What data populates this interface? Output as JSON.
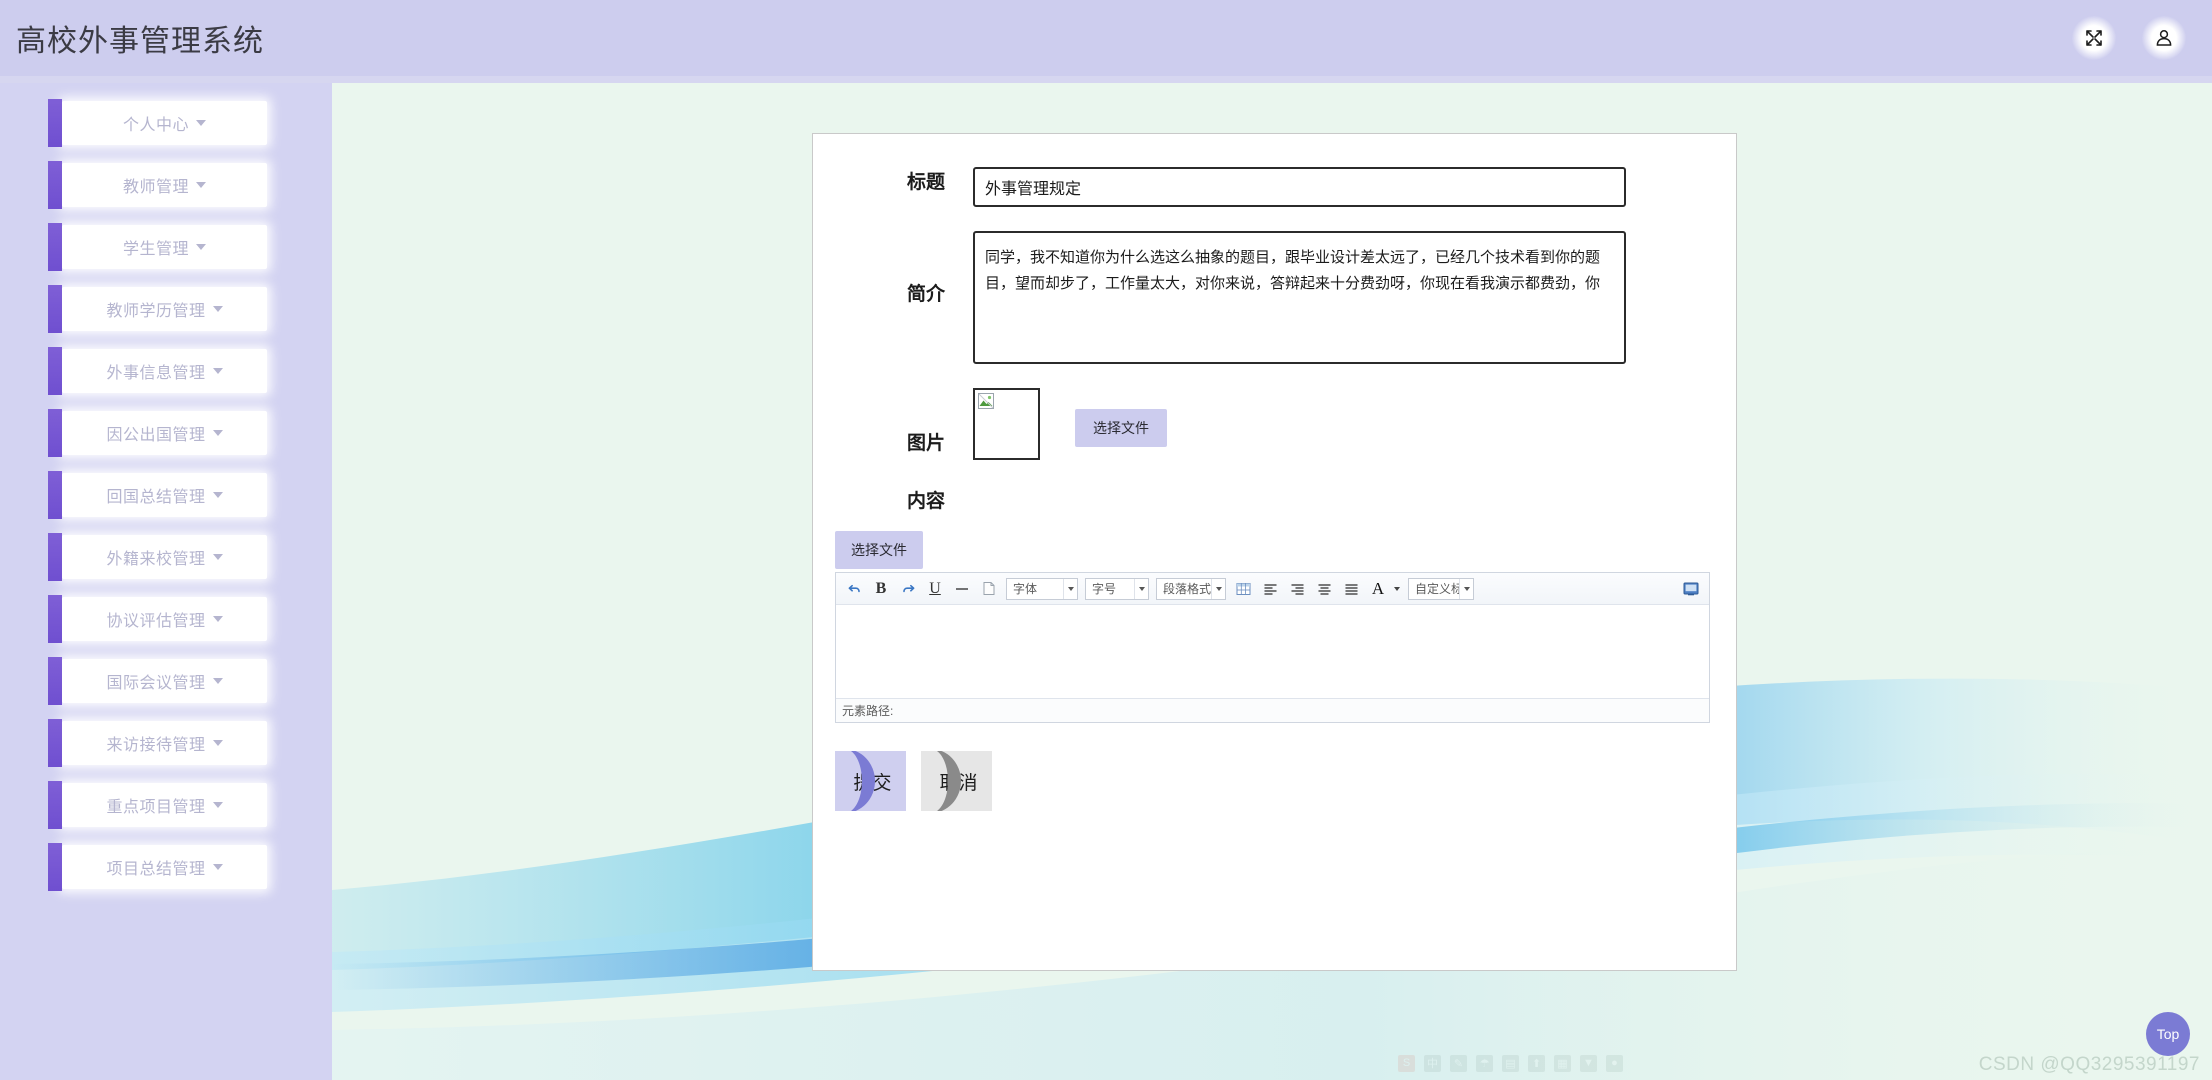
{
  "header": {
    "title": "高校外事管理系统",
    "icons": [
      {
        "name": "expand-icon",
        "label": "全屏"
      },
      {
        "name": "user-icon",
        "label": "用户"
      }
    ]
  },
  "sidebar": {
    "items": [
      {
        "label": "个人中心"
      },
      {
        "label": "教师管理"
      },
      {
        "label": "学生管理"
      },
      {
        "label": "教师学历管理"
      },
      {
        "label": "外事信息管理"
      },
      {
        "label": "因公出国管理"
      },
      {
        "label": "回国总结管理"
      },
      {
        "label": "外籍来校管理"
      },
      {
        "label": "协议评估管理"
      },
      {
        "label": "国际会议管理"
      },
      {
        "label": "来访接待管理"
      },
      {
        "label": "重点项目管理"
      },
      {
        "label": "项目总结管理"
      }
    ]
  },
  "form": {
    "title_label": "标题",
    "title_value": "外事管理规定",
    "title_placeholder": "",
    "intro_label": "简介",
    "intro_value": "同学，我不知道你为什么选这么抽象的题目，跟毕业设计差太远了，已经几个技术看到你的题目，望而却步了，工作量太大，对你来说，答辩起来十分费劲呀，你现在看我演示都费劲，你",
    "intro_placeholder": "",
    "image_label": "图片",
    "image_choose_file": "选择文件",
    "content_label": "内容",
    "editor_choose_file": "选择文件"
  },
  "editor": {
    "buttons": [
      {
        "name": "undo-icon",
        "glyph": "↶"
      },
      {
        "name": "bold-icon",
        "glyph": "B"
      },
      {
        "name": "redo-icon",
        "glyph": "↷"
      },
      {
        "name": "underline-icon",
        "glyph": "U"
      },
      {
        "name": "horizontal-rule-icon",
        "glyph": "—"
      },
      {
        "name": "paste-icon",
        "glyph": "▤"
      }
    ],
    "selects": [
      {
        "name": "font-family-select",
        "value": "字体"
      },
      {
        "name": "font-size-select",
        "value": "字号"
      },
      {
        "name": "paragraph-format-select",
        "value": "段落格式"
      }
    ],
    "align_buttons": [
      {
        "name": "insert-table-icon"
      },
      {
        "name": "align-left-icon"
      },
      {
        "name": "align-right-icon"
      },
      {
        "name": "align-center-icon"
      },
      {
        "name": "align-justify-icon"
      }
    ],
    "font_color_label": "A",
    "custom_heading_value": "自定义标题",
    "fullscreen_icon": "fullscreen-icon",
    "body_value": "",
    "status_label": "元素路径:"
  },
  "actions": {
    "submit_label": "提交",
    "cancel_label": "取消"
  },
  "floating": {
    "top_label": "Top",
    "watermark": "CSDN @QQ3295391197"
  },
  "ime": {
    "items": [
      "S",
      "中",
      "✎",
      "☂",
      "▤",
      "⬆",
      "▦",
      "▼",
      "●"
    ]
  },
  "colors": {
    "header_bg": "#cdcdee",
    "sidebar_bg": "#d3d3f2",
    "nav_accent": "#7f5fd6",
    "page_bg": "#eaf6ee",
    "button_lilac": "#ccccee",
    "top_btn": "#7b7bd4"
  }
}
